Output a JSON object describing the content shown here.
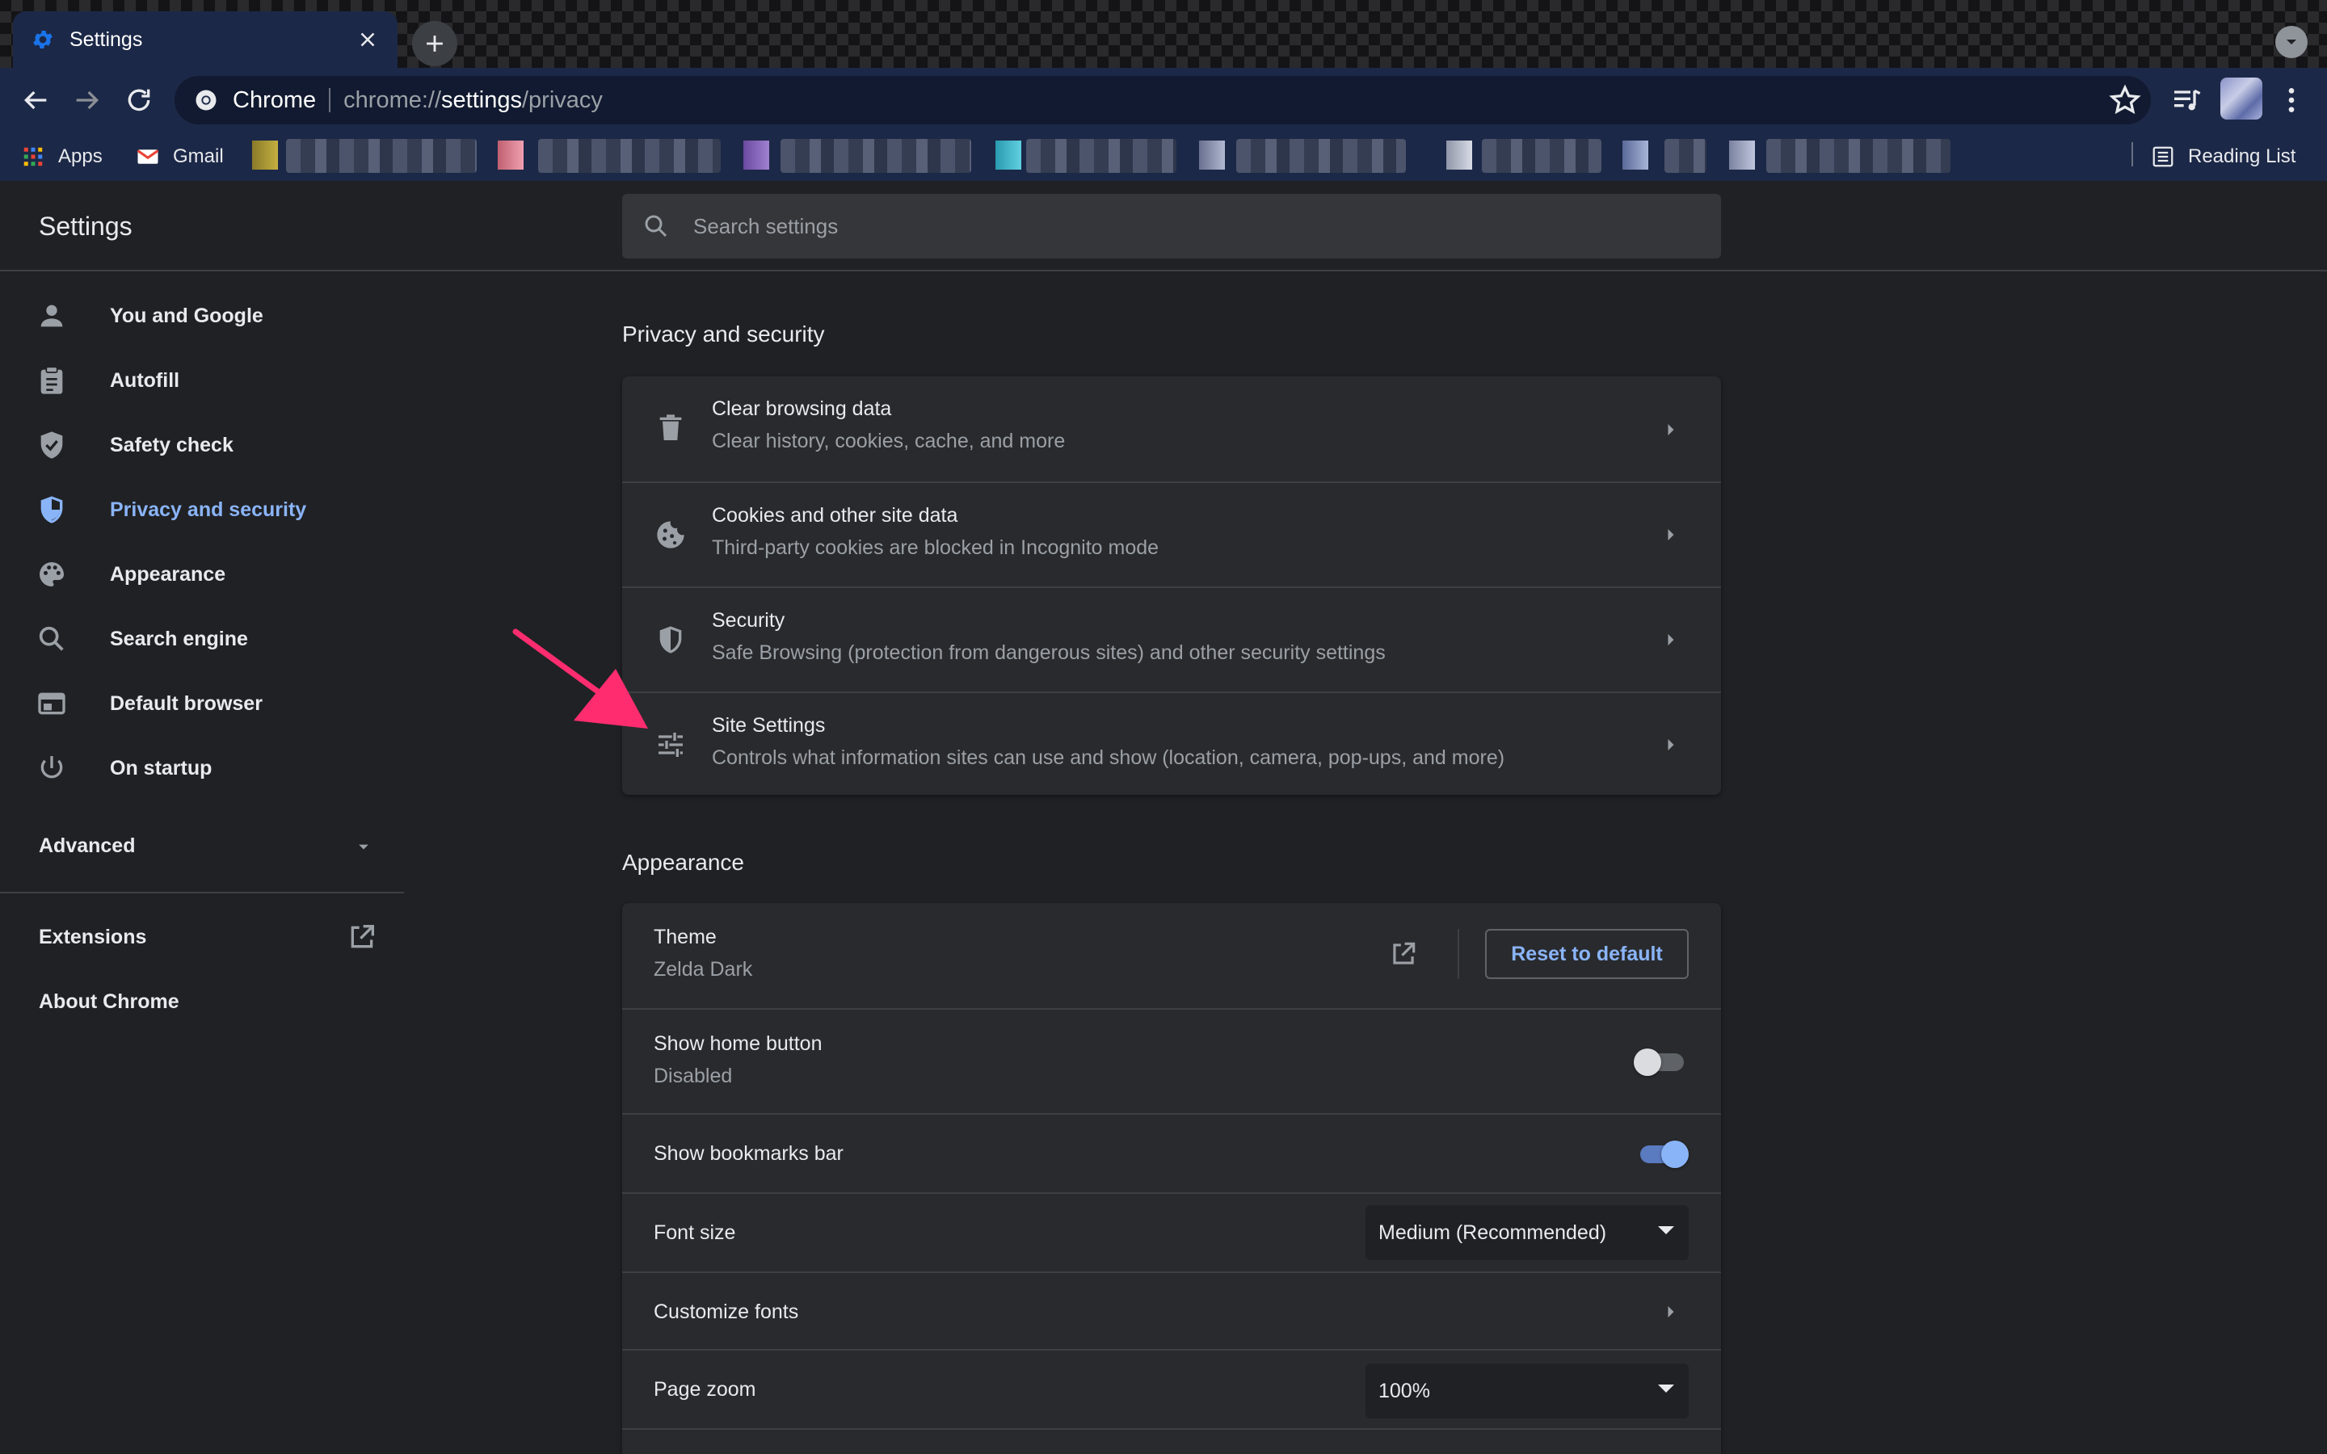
{
  "tab": {
    "title": "Settings"
  },
  "omnibox": {
    "chip": "Chrome",
    "url_prefix": "chrome://",
    "url_host": "settings",
    "url_path": "/privacy"
  },
  "bookmarks": {
    "apps": "Apps",
    "gmail": "Gmail",
    "reading_list": "Reading List"
  },
  "header": {
    "title": "Settings",
    "search_placeholder": "Search settings"
  },
  "sidebar": {
    "items": [
      {
        "label": "You and Google",
        "icon": "person-icon"
      },
      {
        "label": "Autofill",
        "icon": "clipboard-icon"
      },
      {
        "label": "Safety check",
        "icon": "shield-check-icon"
      },
      {
        "label": "Privacy and security",
        "icon": "privacy-shield-icon",
        "active": true
      },
      {
        "label": "Appearance",
        "icon": "palette-icon"
      },
      {
        "label": "Search engine",
        "icon": "search-icon"
      },
      {
        "label": "Default browser",
        "icon": "browser-window-icon"
      },
      {
        "label": "On startup",
        "icon": "power-icon"
      }
    ],
    "advanced": "Advanced",
    "extensions": "Extensions",
    "about": "About Chrome"
  },
  "privacy": {
    "title": "Privacy and security",
    "rows": [
      {
        "title": "Clear browsing data",
        "subtitle": "Clear history, cookies, cache, and more",
        "icon": "trash-icon"
      },
      {
        "title": "Cookies and other site data",
        "subtitle": "Third-party cookies are blocked in Incognito mode",
        "icon": "cookie-icon"
      },
      {
        "title": "Security",
        "subtitle": "Safe Browsing (protection from dangerous sites) and other security settings",
        "icon": "security-shield-icon"
      },
      {
        "title": "Site Settings",
        "subtitle": "Controls what information sites can use and show (location, camera, pop-ups, and more)",
        "icon": "tune-sliders-icon"
      }
    ]
  },
  "appearance": {
    "title": "Appearance",
    "theme_label": "Theme",
    "theme_value": "Zelda Dark",
    "reset_button": "Reset to default",
    "home_button_label": "Show home button",
    "home_button_value": "Disabled",
    "home_button_on": false,
    "bookmarks_bar_label": "Show bookmarks bar",
    "bookmarks_bar_on": true,
    "font_size_label": "Font size",
    "font_size_value": "Medium (Recommended)",
    "customize_fonts_label": "Customize fonts",
    "page_zoom_label": "Page zoom",
    "page_zoom_value": "100%"
  },
  "colors": {
    "accent": "#8ab4f8",
    "annotation_arrow": "#ff2d6f",
    "toolbar": "#1c2847"
  }
}
